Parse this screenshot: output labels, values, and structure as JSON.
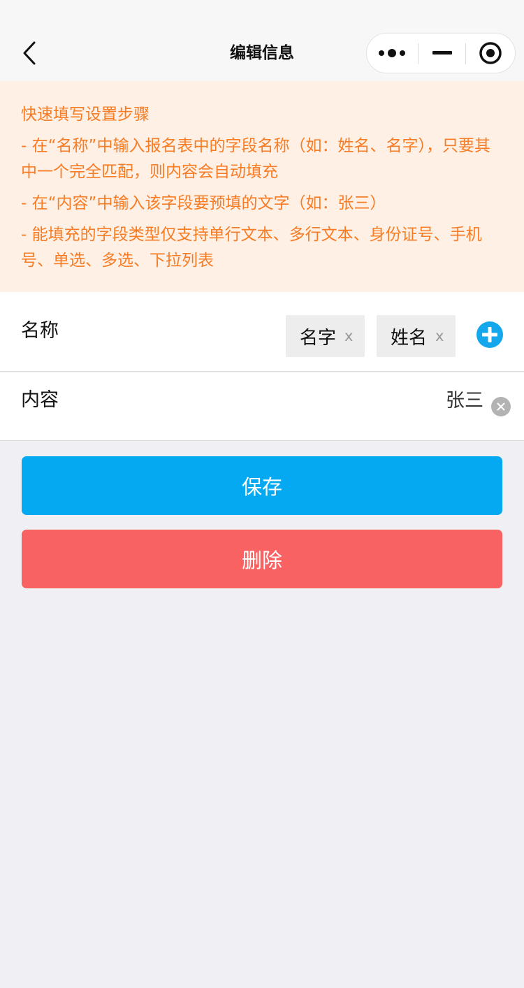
{
  "navbar": {
    "title": "编辑信息",
    "icons": [
      "chevron-left-icon",
      "more-dots-icon",
      "minimize-icon",
      "close-target-icon"
    ]
  },
  "notice": {
    "title": "快速填写设置步骤",
    "tips": [
      "- 在“名称”中输入报名表中的字段名称（如：姓名、名字），只要其中一个完全匹配，则内容会自动填充",
      "- 在“内容”中输入该字段要预填的文字（如：张三）",
      "- 能填充的字段类型仅支持单行文本、多行文本、身份证号、手机号、单选、多选、下拉列表"
    ],
    "color": "#f77c24",
    "background": "#fff0e6"
  },
  "name_row": {
    "label": "名称",
    "tags": [
      {
        "text": "名字",
        "remove": "x"
      },
      {
        "text": "姓名",
        "remove": "x"
      }
    ],
    "add_icon": "plus-circle-icon"
  },
  "content_row": {
    "label": "内容",
    "value": "张三",
    "clear_icon": "clear-circle-icon"
  },
  "buttons": {
    "save": {
      "label": "保存",
      "color": "#05a9f1"
    },
    "delete": {
      "label": "删除",
      "color": "#f86262"
    }
  }
}
